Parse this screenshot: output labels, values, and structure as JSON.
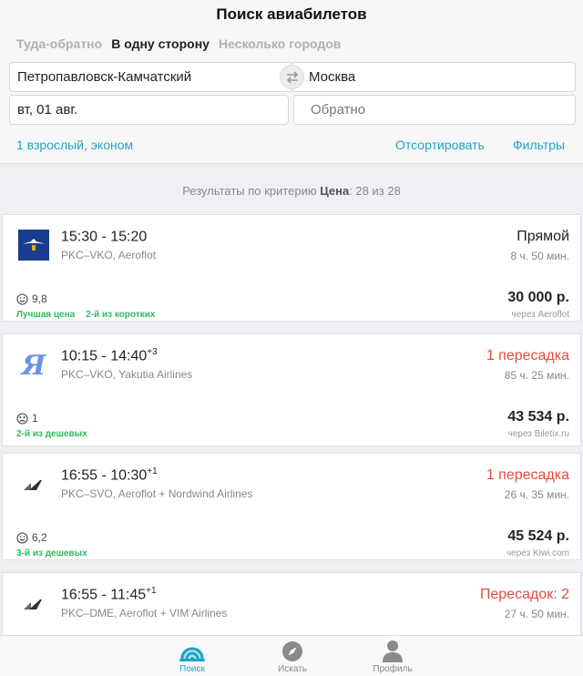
{
  "header": {
    "title": "Поиск авиабилетов",
    "trip_types": [
      {
        "label": "Туда-обратно",
        "active": false
      },
      {
        "label": "В одну сторону",
        "active": true
      },
      {
        "label": "Несколько городов",
        "active": false
      }
    ],
    "from": "Петропавловск-Камчатский",
    "to": "Москва",
    "date": "вт, 01 авг.",
    "return_placeholder": "Обратно",
    "passengers": "1 взрослый, эконом",
    "sort_label": "Отсортировать",
    "filters_label": "Фильтры"
  },
  "summary": {
    "prefix": "Результаты по критерию",
    "criterion": "Цена",
    "count": ": 28 из 28"
  },
  "flights": [
    {
      "logo_icon": "aeroflot-logo-icon",
      "times": "15:30 - 15:20",
      "day_offset": "",
      "route": "PKC–VKO, Aeroflot",
      "stops": "Прямой",
      "duration": "8 ч. 50 мин.",
      "rating_icon": "smile-icon",
      "rating": "9,8",
      "badges": [
        "Лучшая цена",
        "2-й из коротких"
      ],
      "price": "30 000 р.",
      "agent": "через Aeroflot"
    },
    {
      "logo_icon": "yakutia-logo-icon",
      "times": "10:15 - 14:40",
      "day_offset": "+3",
      "route": "PKC–VKO, Yakutia Airlines",
      "stops": "1 пересадка",
      "duration": "85 ч. 25 мин.",
      "rating_icon": "sad-icon",
      "rating": "1",
      "badges": [
        "2-й из дешевых"
      ],
      "price": "43 534 р.",
      "agent": "через Biletix.ru"
    },
    {
      "logo_icon": "multi-airline-icon",
      "times": "16:55 - 10:30",
      "day_offset": "+1",
      "route": "PKC–SVO, Aeroflot + Nordwind Airlines",
      "stops": "1 пересадка",
      "duration": "26 ч. 35 мин.",
      "rating_icon": "smile-icon",
      "rating": "6,2",
      "badges": [
        "3-й из дешевых"
      ],
      "price": "45 524 р.",
      "agent": "через Kiwi.com"
    },
    {
      "logo_icon": "multi-airline-icon",
      "times": "16:55 - 11:45",
      "day_offset": "+1",
      "route": "PKC–DME, Aeroflot + VIM Airlines",
      "stops": "Пересадок: 2",
      "duration": "27 ч. 50 мин."
    }
  ],
  "tabbar": {
    "search": "Поиск",
    "explore": "Искать",
    "profile": "Профиль"
  },
  "colors": {
    "accent": "#1ea3c9",
    "stops_red": "#e44a3e",
    "badge_green": "#2bbd5a"
  }
}
